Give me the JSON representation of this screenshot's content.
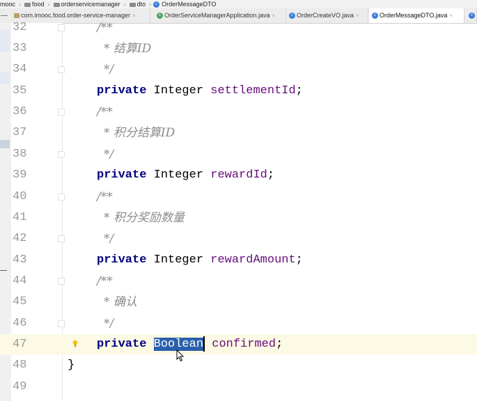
{
  "breadcrumb": {
    "items": [
      "mooc",
      "food",
      "orderservicemanager",
      "dto",
      "OrderMessageDTO"
    ]
  },
  "tabs": [
    {
      "label": "com.imooc.food.order-service-manager",
      "icon": "package-icon",
      "active": false
    },
    {
      "label": "OrderServiceManagerApplication.java",
      "icon": "spring-class-icon",
      "active": false
    },
    {
      "label": "OrderCreateVO.java",
      "icon": "class-icon",
      "active": false
    },
    {
      "label": "OrderMessageDTO.java",
      "icon": "class-icon",
      "active": true
    }
  ],
  "editor": {
    "lines": [
      {
        "num": "32",
        "text": "/**"
      },
      {
        "num": "33",
        "text": "* 结算ID"
      },
      {
        "num": "34",
        "text": "*/"
      },
      {
        "num": "35",
        "kw": "private",
        "type": "Integer",
        "field": "settlementId",
        "end": ";"
      },
      {
        "num": "36",
        "text": "/**"
      },
      {
        "num": "37",
        "text": "* 积分结算ID"
      },
      {
        "num": "38",
        "text": "*/"
      },
      {
        "num": "39",
        "kw": "private",
        "type": "Integer",
        "field": "rewardId",
        "end": ";"
      },
      {
        "num": "40",
        "text": "/**"
      },
      {
        "num": "41",
        "text": "* 积分奖励数量"
      },
      {
        "num": "42",
        "text": "*/"
      },
      {
        "num": "43",
        "kw": "private",
        "type": "Integer",
        "field": "rewardAmount",
        "end": ";"
      },
      {
        "num": "44",
        "text": "/**"
      },
      {
        "num": "45",
        "text": "* 确认"
      },
      {
        "num": "46",
        "text": "*/"
      },
      {
        "num": "47",
        "kw": "private",
        "type": "Boolean",
        "field": "confirmed",
        "end": ";"
      },
      {
        "num": "48",
        "text": "}"
      },
      {
        "num": "49",
        "text": ""
      }
    ]
  },
  "colors": {
    "keyword": "#000080",
    "field": "#660e7a",
    "comment": "#8c8c8c",
    "selection": "#2a5faa",
    "current_line": "#fcf9e4"
  }
}
